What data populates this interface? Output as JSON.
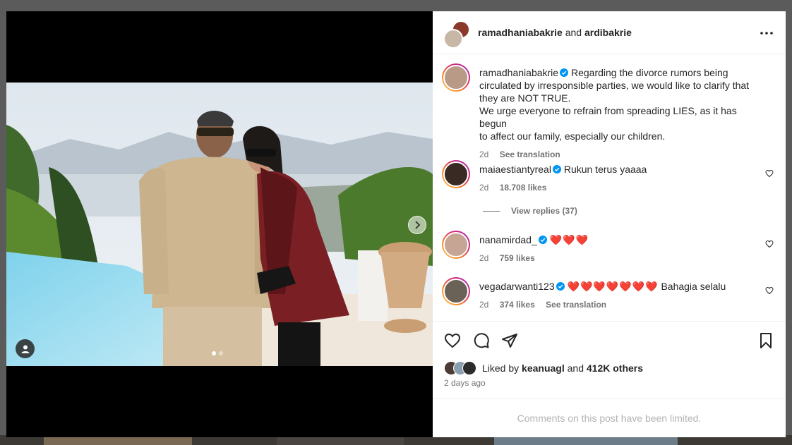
{
  "post": {
    "author": "ramadhaniabakrie",
    "joiner": "and",
    "coauthor": "ardibakrie",
    "caption": {
      "user": "ramadhaniabakrie",
      "line1": "Regarding the divorce rumors being",
      "line2": "circulated by irresponsible parties, we would like to clarify that",
      "line3": "they are NOT TRUE.",
      "line4": "We urge everyone to refrain from spreading LIES, as it has begun",
      "line5": "to affect our family, especially our children.",
      "age": "2d",
      "translation": "See translation"
    }
  },
  "comments": [
    {
      "user": "maiaestiantyreal",
      "text": "Rukun terus yaaaa",
      "age": "2d",
      "likes": "18.708 likes"
    },
    {
      "user": "nanamirdad_",
      "text": "❤️❤️❤️",
      "age": "2d",
      "likes": "759 likes"
    },
    {
      "user": "vegadarwanti123",
      "text": "❤️❤️❤️❤️❤️❤️❤️",
      "extra": "Bahagia selalu",
      "age": "2d",
      "likes": "374 likes",
      "translation": "See translation"
    }
  ],
  "view_replies": "View replies (37)",
  "likes": {
    "prefix": "Liked by",
    "user": "keanuagl",
    "joiner": "and",
    "others": "412K others"
  },
  "timestamp": "2 days ago",
  "limited_notice": "Comments on this post have been limited.",
  "carousel": {
    "current": 1,
    "total": 2
  },
  "icons": [
    "more-icon",
    "verified-icon",
    "heart-icon",
    "comment-icon",
    "share-icon",
    "bookmark-icon",
    "chevron-right-icon",
    "user-tag-icon"
  ],
  "colors": {
    "accent": "#0095f6",
    "heart": "#e0213a",
    "muted": "#737373"
  }
}
